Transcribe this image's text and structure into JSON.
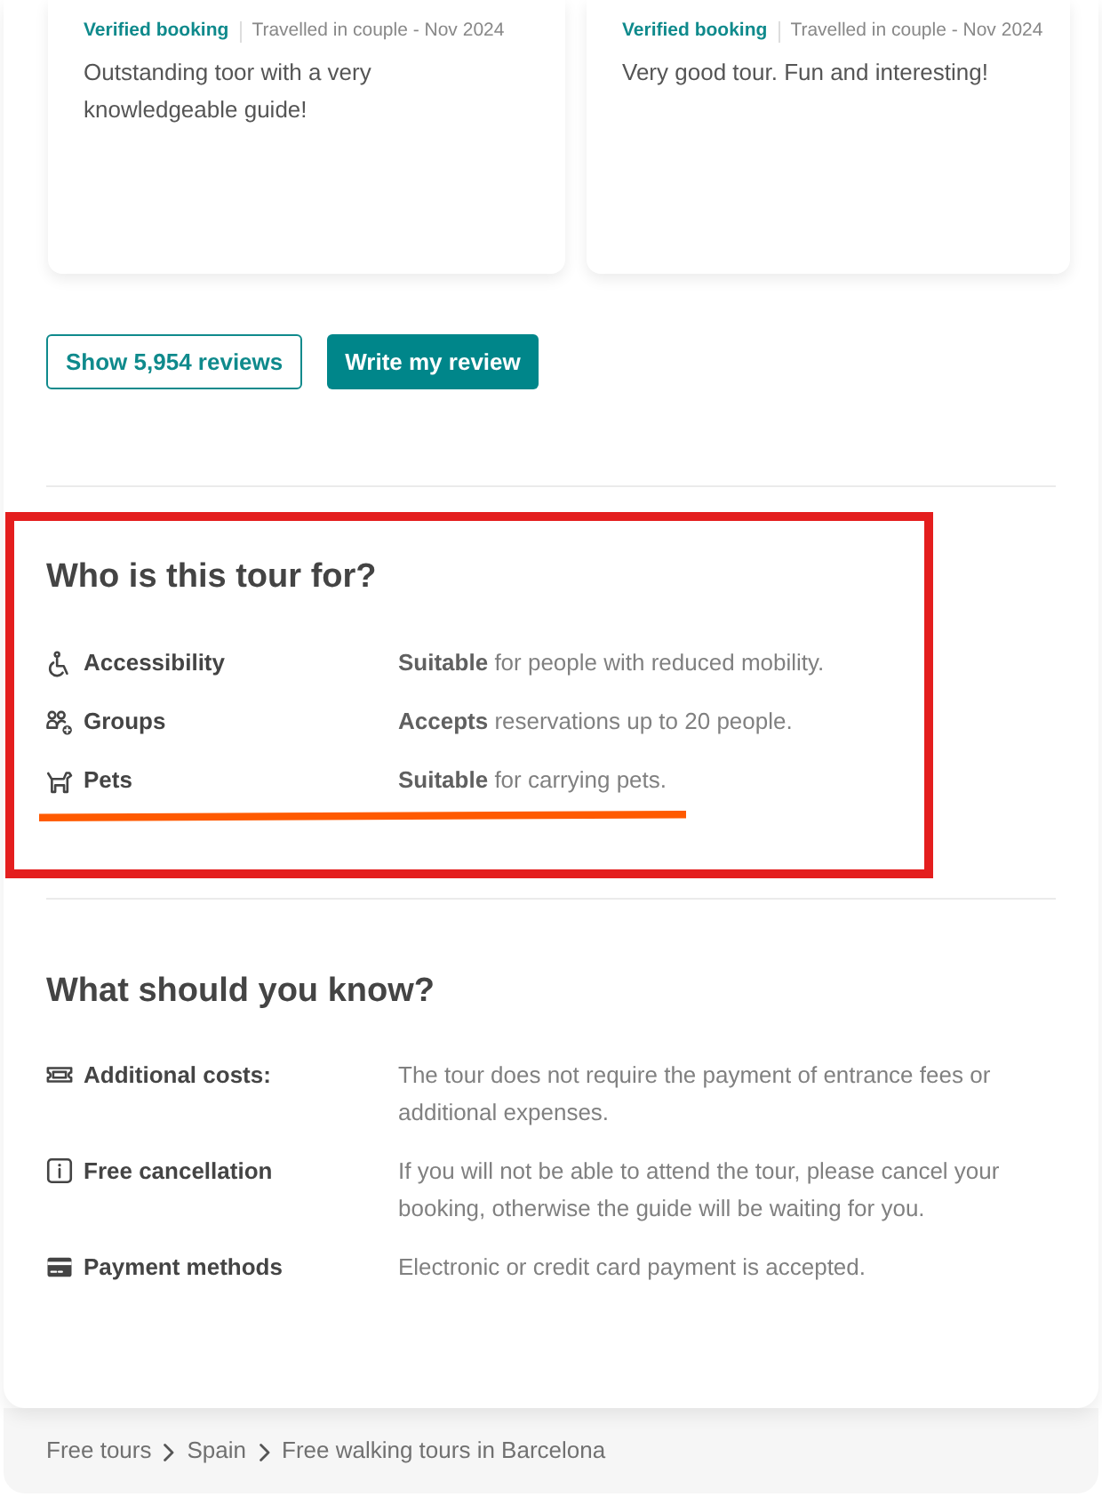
{
  "reviews": [
    {
      "verified": "Verified booking",
      "meta": "Travelled in couple - Nov 2024",
      "text": "Outstanding toor with a very knowledgeable guide!"
    },
    {
      "verified": "Verified booking",
      "meta": "Travelled in couple - Nov 2024",
      "text": "Very good tour. Fun and interesting!"
    }
  ],
  "review_buttons": [
    {
      "label": "Show 5,954 reviews",
      "kind": "outline"
    },
    {
      "label": "Write my review",
      "kind": "filled"
    }
  ],
  "audience": {
    "title": "Who is this tour for?",
    "highlighted": true,
    "items": [
      {
        "label": "Accessibility",
        "value": "**Suitable** for people with reduced mobility.",
        "underlined": false
      },
      {
        "label": "Groups",
        "value": "**Accepts** reservations up to 20 people.",
        "underlined": false
      },
      {
        "label": "Pets",
        "value": "**Suitable** for carrying pets.",
        "underlined": true
      }
    ]
  },
  "know": {
    "title": "What should you know?",
    "items": [
      {
        "label": "Additional costs:",
        "value": "The tour does not require the payment of entrance fees or additional expenses."
      },
      {
        "label": "Free cancellation",
        "value": "If you will not be able to attend the tour, please cancel your booking, otherwise the guide will be waiting for you."
      },
      {
        "label": "Payment methods",
        "value": "Electronic or credit card payment is accepted."
      }
    ]
  },
  "breadcrumb": [
    {
      "label": "Free tours"
    },
    {
      "label": "Spain"
    },
    {
      "label": "Free walking tours in Barcelona"
    }
  ]
}
